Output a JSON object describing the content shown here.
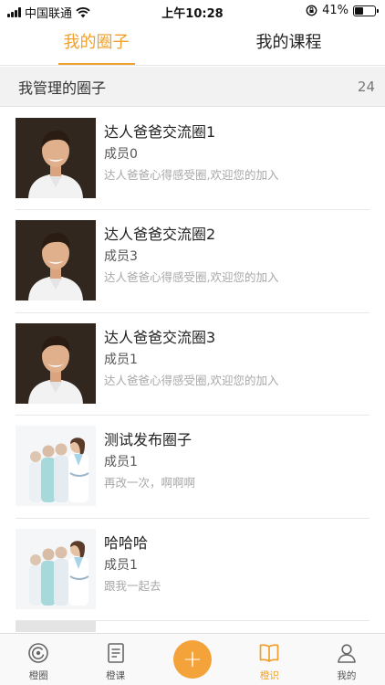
{
  "status_bar": {
    "carrier": "中国联通",
    "time": "上午10:28",
    "battery": "41%",
    "battery_level": 0.41
  },
  "tabs": [
    {
      "label": "我的圈子",
      "active": true
    },
    {
      "label": "我的课程",
      "active": false
    }
  ],
  "section": {
    "title": "我管理的圈子",
    "count": "24"
  },
  "circles": [
    {
      "title": "达人爸爸交流圈1",
      "members": "成员0",
      "desc": "达人爸爸心得感受圈,欢迎您的加入",
      "thumb": "man-portrait"
    },
    {
      "title": "达人爸爸交流圈2",
      "members": "成员3",
      "desc": "达人爸爸心得感受圈,欢迎您的加入",
      "thumb": "man-portrait"
    },
    {
      "title": "达人爸爸交流圈3",
      "members": "成员1",
      "desc": "达人爸爸心得感受圈,欢迎您的加入",
      "thumb": "man-portrait"
    },
    {
      "title": "测试发布圈子",
      "members": "成员1",
      "desc": "再改一次，啊啊啊",
      "thumb": "medical-team"
    },
    {
      "title": "哈哈哈",
      "members": "成员1",
      "desc": "跟我一起去",
      "thumb": "medical-team"
    }
  ],
  "bottom_nav": [
    {
      "label": "橙圈",
      "icon": "circle-icon",
      "active": false
    },
    {
      "label": "橙课",
      "icon": "course-icon",
      "active": false
    },
    {
      "label": "",
      "icon": "plus-icon",
      "active": false
    },
    {
      "label": "橙识",
      "icon": "book-icon",
      "active": true
    },
    {
      "label": "我的",
      "icon": "user-icon",
      "active": false
    }
  ],
  "colors": {
    "accent": "#f0a02c",
    "plus_button": "#f3a33a",
    "desc_text": "#a8a8a8"
  }
}
